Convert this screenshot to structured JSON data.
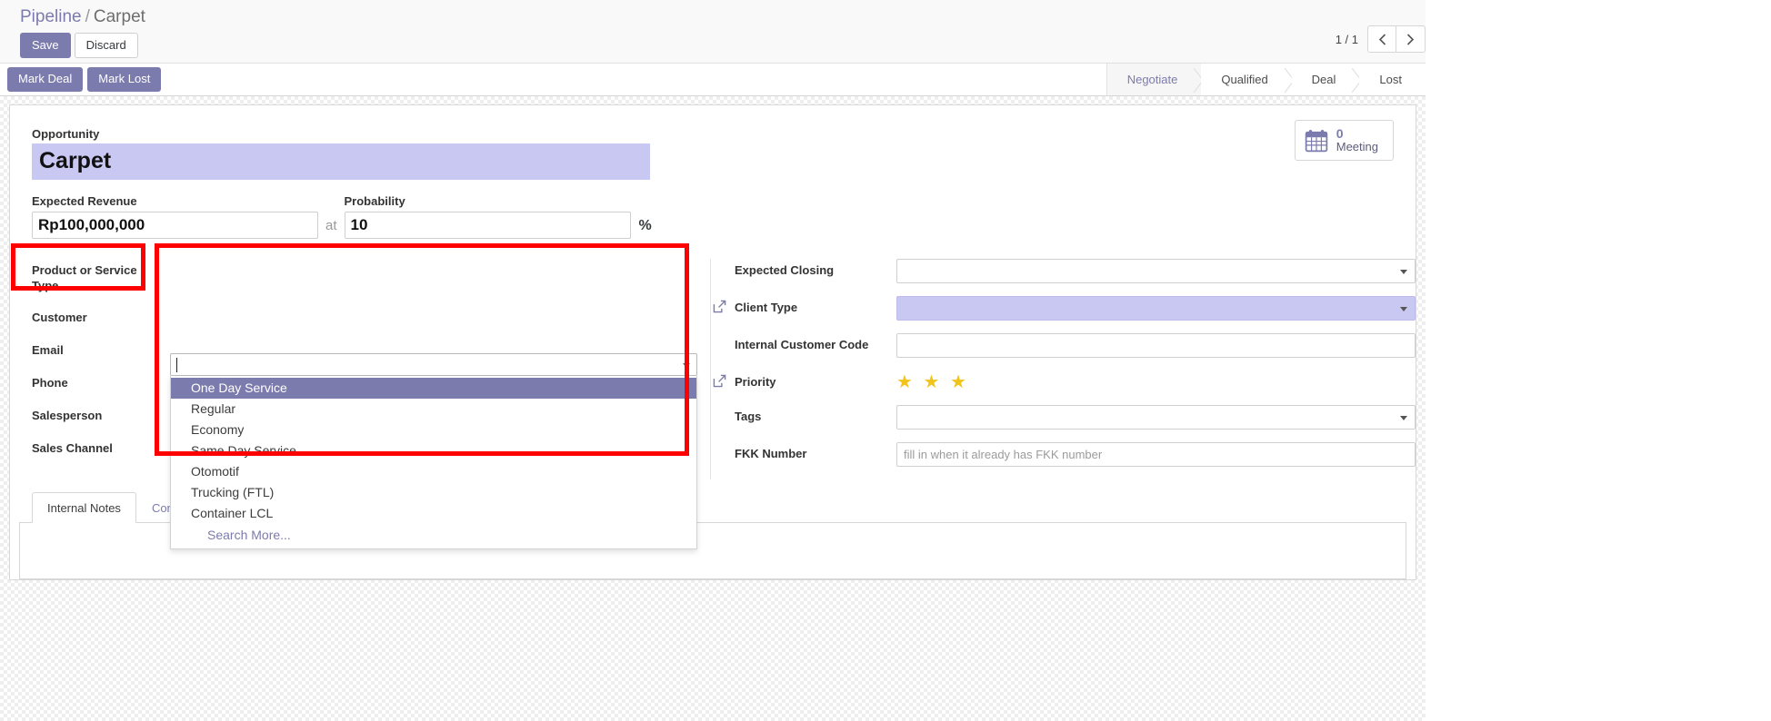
{
  "breadcrumb": {
    "root": "Pipeline",
    "separator": "/",
    "current": "Carpet"
  },
  "controls": {
    "save_label": "Save",
    "discard_label": "Discard",
    "mark_deal_label": "Mark Deal",
    "mark_lost_label": "Mark Lost"
  },
  "pager": {
    "count": "1 / 1",
    "prev_icon": "chevron-left-icon",
    "next_icon": "chevron-right-icon"
  },
  "statusbar": {
    "stages": [
      {
        "label": "Negotiate",
        "active": true
      },
      {
        "label": "Qualified",
        "active": false
      },
      {
        "label": "Deal",
        "active": false
      },
      {
        "label": "Lost",
        "active": false
      }
    ]
  },
  "stat_buttons": [
    {
      "icon": "calendar-icon",
      "value": "0",
      "label": "Meeting"
    }
  ],
  "form": {
    "opportunity_label": "Opportunity",
    "opportunity_value": "Carpet",
    "expected_revenue_label": "Expected Revenue",
    "expected_revenue_value": "Rp100,000,000",
    "at_text": "at",
    "probability_label": "Probability",
    "probability_value": "10",
    "percent_text": "%",
    "left_fields": [
      {
        "label": "Product or Service Type",
        "value": ""
      },
      {
        "label": "Customer",
        "value": ""
      },
      {
        "label": "Email",
        "value": ""
      },
      {
        "label": "Phone",
        "value": ""
      },
      {
        "label": "Salesperson",
        "value": ""
      },
      {
        "label": "Sales Channel",
        "value": ""
      }
    ],
    "right_fields": [
      {
        "label": "Expected Closing",
        "value": "",
        "type": "select",
        "highlighted": false,
        "ext_link": false
      },
      {
        "label": "Client Type",
        "value": "",
        "type": "select",
        "highlighted": true,
        "ext_link": true
      },
      {
        "label": "Internal Customer Code",
        "value": "",
        "type": "text",
        "highlighted": false,
        "ext_link": false
      },
      {
        "label": "Priority",
        "value": "",
        "type": "stars",
        "highlighted": false,
        "ext_link": true
      },
      {
        "label": "Tags",
        "value": "",
        "type": "select",
        "highlighted": false,
        "ext_link": false
      },
      {
        "label": "FKK Number",
        "value": "",
        "type": "text",
        "placeholder": "fill in when it already has FKK number",
        "highlighted": false,
        "ext_link": false
      }
    ],
    "priority_stars": "★ ★ ★"
  },
  "dropdown": {
    "open": true,
    "search_value": "",
    "options": [
      "One Day Service",
      "Regular",
      "Economy",
      "Same Day Service",
      "Otomotif",
      "Trucking (FTL)",
      "Container LCL"
    ],
    "selected_index": 0,
    "search_more_label": "Search More..."
  },
  "notebook": {
    "tabs": [
      {
        "label": "Internal Notes",
        "active": true
      },
      {
        "label": "Contact Information",
        "active": false
      }
    ]
  },
  "colors": {
    "accent": "#7c7bad",
    "highlight_field": "#c9c8f2",
    "annotation": "#ff0000",
    "star": "#f0c419"
  }
}
